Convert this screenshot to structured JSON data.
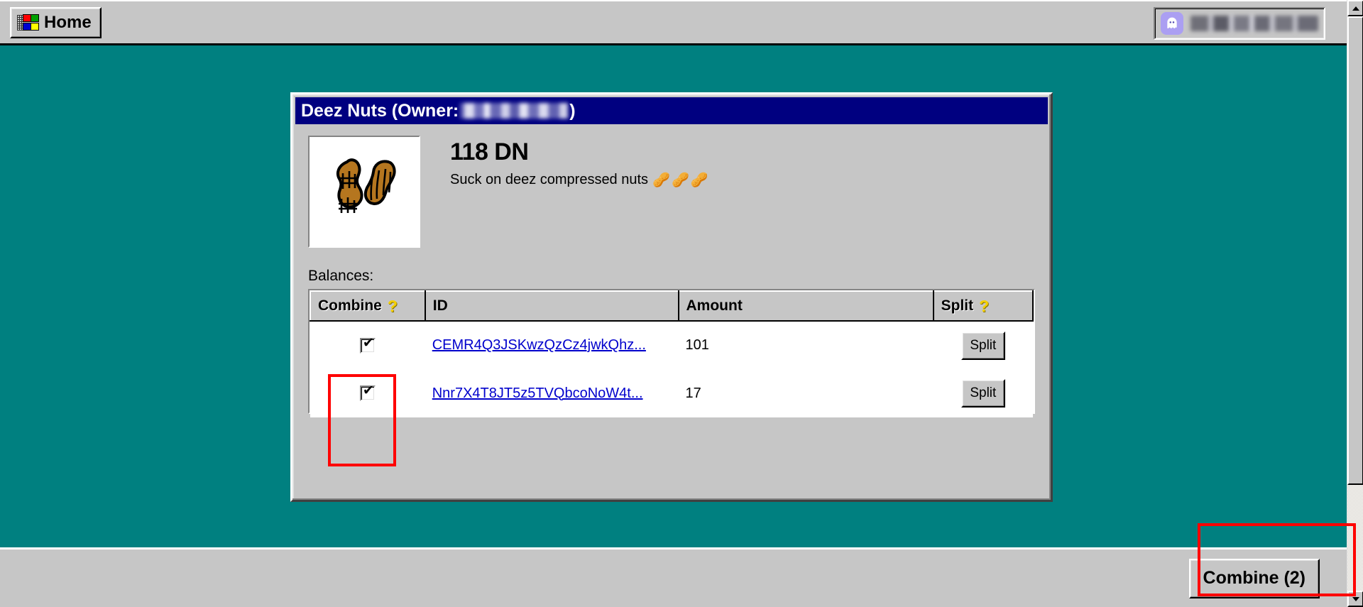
{
  "taskbar": {
    "home_label": "Home",
    "home_icon": "windows-flag-icon",
    "wallet_icon": "ghost-icon",
    "wallet_address": ""
  },
  "window": {
    "title_prefix": "Deez Nuts (Owner:",
    "title_suffix": ")",
    "owner": ""
  },
  "token": {
    "image_icon": "peanuts-image",
    "amount": "118 DN",
    "description": "Suck on deez compressed nuts",
    "emojis": "🥜🥜🥜"
  },
  "balances": {
    "label": "Balances:",
    "columns": [
      {
        "key": "combine",
        "label": "Combine",
        "help_icon": "?",
        "muted": true
      },
      {
        "key": "id",
        "label": "ID",
        "muted": false
      },
      {
        "key": "amount",
        "label": "Amount",
        "muted": false
      },
      {
        "key": "split",
        "label": "Split",
        "help_icon": "?",
        "muted": true
      }
    ],
    "rows": [
      {
        "checked": true,
        "id": "CEMR4Q3JSKwzQzCz4jwkQhz...",
        "amount": "101",
        "split_label": "Split"
      },
      {
        "checked": true,
        "id": "Nnr7X4T8JT5z5TVQbcoNoW4t...",
        "amount": "17",
        "split_label": "Split"
      }
    ]
  },
  "actions": {
    "combine_label": "Combine (2)"
  },
  "scrollbar": {
    "up_icon": "triangle-up-icon",
    "down_icon": "triangle-down-icon"
  },
  "colors": {
    "desktop": "#008080",
    "chrome": "#c6c6c6",
    "titlebar": "#000080",
    "link": "#0000cc",
    "annotation": "#ff0000",
    "help": "#f5d000"
  }
}
